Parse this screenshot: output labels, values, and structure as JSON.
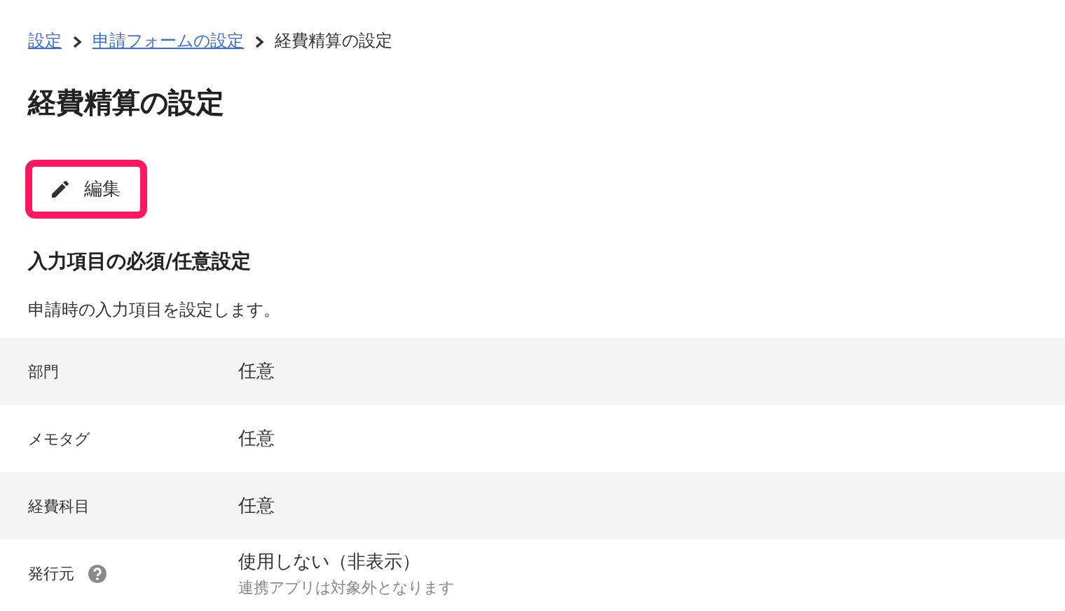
{
  "breadcrumb": [
    {
      "label": "設定",
      "kind": "link"
    },
    {
      "label": "申請フォームの設定",
      "kind": "link"
    },
    {
      "label": "経費精算の設定",
      "kind": "current"
    }
  ],
  "title": "経費精算の設定",
  "edit_button": {
    "label": "編集",
    "highlighted": true
  },
  "section": {
    "heading": "入力項目の必須/任意設定",
    "description": "申請時の入力項目を設定します。"
  },
  "rows": [
    {
      "label": "部門",
      "value": "任意"
    },
    {
      "label": "メモタグ",
      "value": "任意"
    },
    {
      "label": "経費科目",
      "value": "任意"
    },
    {
      "label": "発行元",
      "value": "使用しない（非表示）",
      "note": "連携アプリは対象外となります",
      "help": true
    }
  ]
}
